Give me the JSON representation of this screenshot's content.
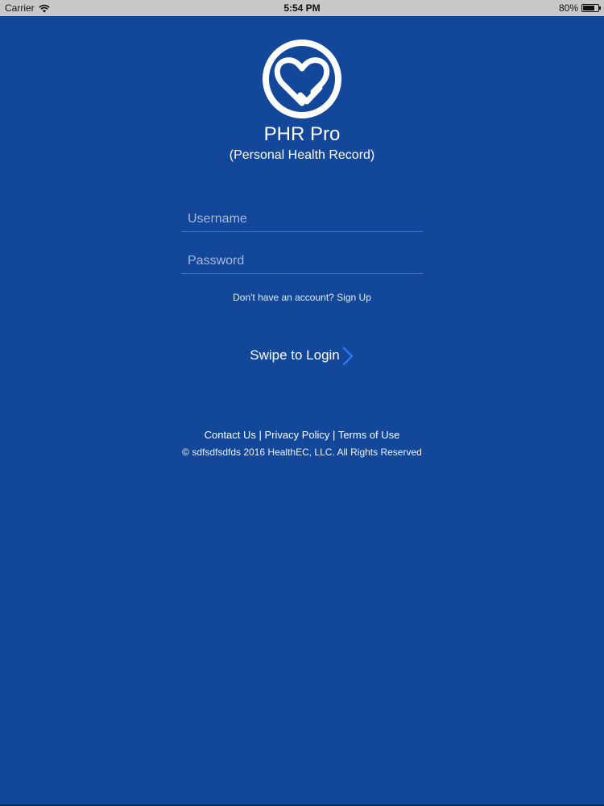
{
  "status_bar": {
    "carrier": "Carrier",
    "time": "5:54 PM",
    "battery": "80%",
    "battery_level": 0.8,
    "wifi_icon": "wifi-icon"
  },
  "app": {
    "logo_icon": "heart-check-icon",
    "title": "PHR Pro",
    "subtitle": "(Personal Health Record)"
  },
  "login": {
    "username_placeholder": "Username",
    "password_placeholder": "Password",
    "signup_prefix": "Don't have an account? ",
    "signup_link": "Sign Up",
    "swipe_label": "Swipe to Login"
  },
  "footer": {
    "contact": "Contact Us",
    "separator": " | ",
    "privacy": "Privacy Policy",
    "terms": "Terms of Use",
    "copyright": "© sdfsdfsdfds 2016 HealthEC, LLC. All Rights Reserved"
  },
  "colors": {
    "background": "#13479a",
    "accent": "#2f7bff",
    "status_bar": "#c8c8c8"
  }
}
